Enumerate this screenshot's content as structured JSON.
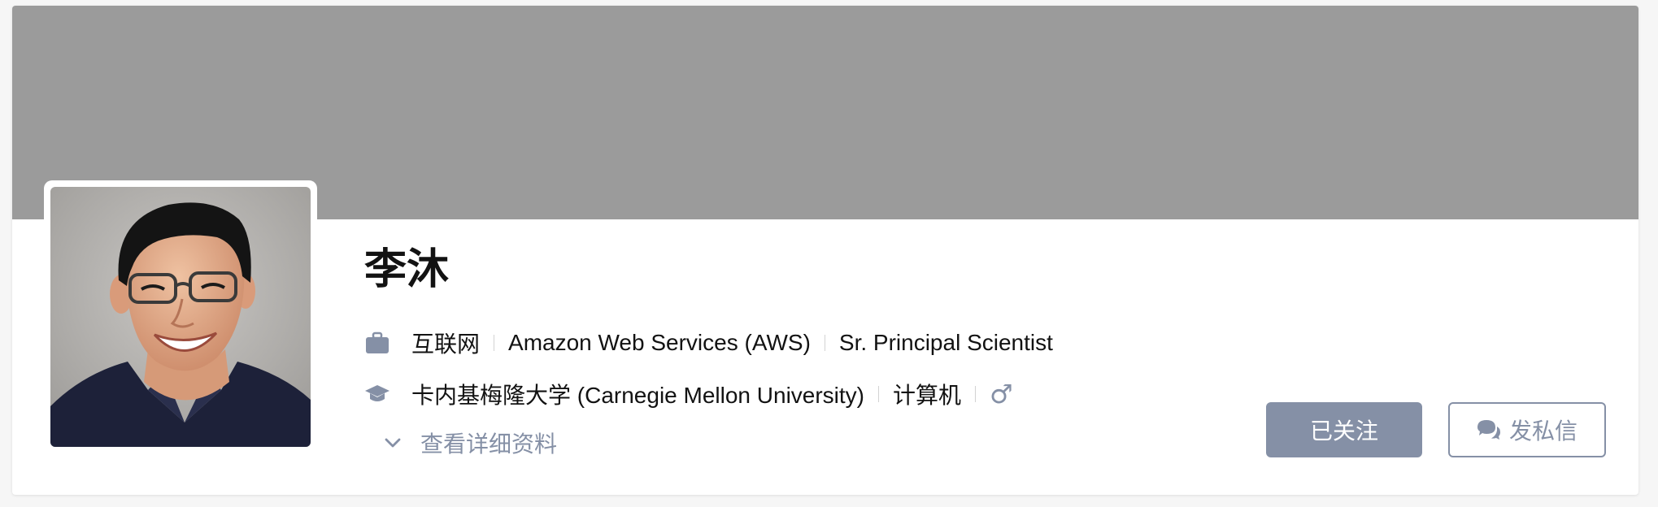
{
  "profile": {
    "name": "李沐",
    "industry": "互联网",
    "company": "Amazon Web Services (AWS)",
    "position": "Sr. Principal Scientist",
    "school": "卡内基梅隆大学 (Carnegie Mellon University)",
    "major": "计算机",
    "gender_symbol": "♂",
    "expand_label": "查看详细资料"
  },
  "actions": {
    "follow_label": "已关注",
    "message_label": "发私信"
  },
  "colors": {
    "cover": "#9b9b9b",
    "muted_accent": "#8590a6",
    "text": "#121212"
  },
  "icons": [
    "briefcase-icon",
    "graduation-cap-icon",
    "male-gender-icon",
    "chevron-down-icon",
    "chat-bubbles-icon"
  ]
}
